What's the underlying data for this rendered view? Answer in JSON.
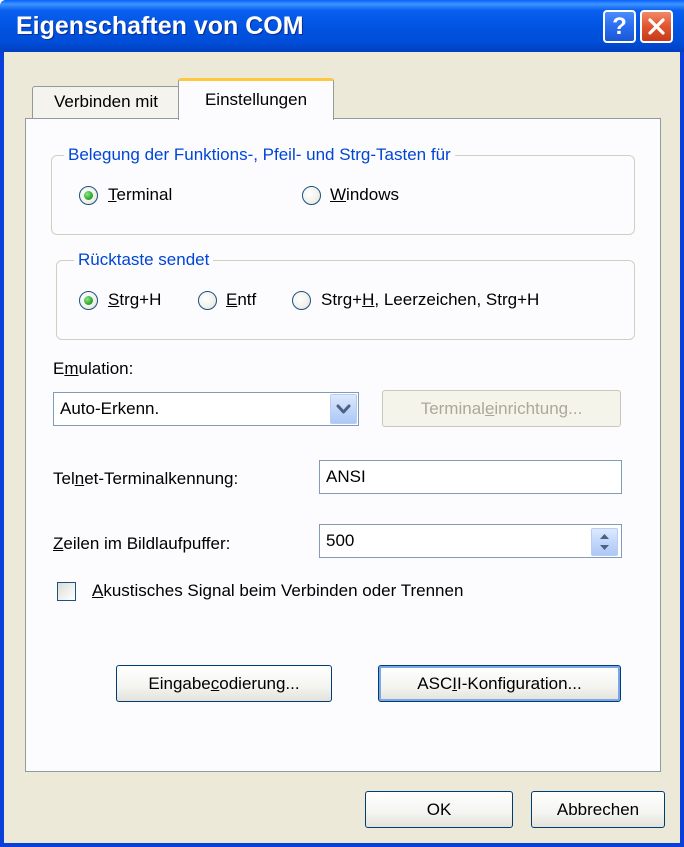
{
  "window": {
    "title": "Eigenschaften von COM",
    "help_glyph": "?",
    "close_glyph": "✕"
  },
  "tabs": [
    {
      "label": "Verbinden mit",
      "active": false
    },
    {
      "label": "Einstellungen",
      "active": true
    }
  ],
  "keys_group": {
    "legend": "Belegung der Funktions-, Pfeil- und Strg-Tasten für",
    "options": [
      {
        "label_pre": "",
        "label_ul": "T",
        "label_post": "erminal",
        "checked": true
      },
      {
        "label_pre": "",
        "label_ul": "W",
        "label_post": "indows",
        "checked": false
      }
    ]
  },
  "backspace_group": {
    "legend": "Rücktaste sendet",
    "options": [
      {
        "label_pre": "",
        "label_ul": "S",
        "label_post": "trg+H",
        "checked": true
      },
      {
        "label_pre": "",
        "label_ul": "E",
        "label_post": "ntf",
        "checked": false
      },
      {
        "label_pre": "Strg+",
        "label_ul": "H",
        "label_post": ", Leerzeichen, Strg+H",
        "checked": false
      }
    ]
  },
  "emulation": {
    "label_pre": "E",
    "label_ul": "m",
    "label_post": "ulation:",
    "value": "Auto-Erkenn.",
    "terminal_button_pre": "Terminal",
    "terminal_button_ul": "e",
    "terminal_button_post": "inrichtung..."
  },
  "telnet": {
    "label_pre": "Tel",
    "label_ul": "n",
    "label_post": "et-Terminalkennung:",
    "value": "ANSI"
  },
  "scrollback": {
    "label_pre": "",
    "label_ul": "Z",
    "label_post": "eilen im Bildlaufpuffer:",
    "value": "500"
  },
  "beep": {
    "label_pre": "",
    "label_ul": "A",
    "label_post": "kustisches Signal beim Verbinden oder Trennen",
    "checked": false
  },
  "buttons": {
    "input_encoding_pre": "Eingabe",
    "input_encoding_ul": "c",
    "input_encoding_post": "odierung...",
    "ascii_pre": "ASC",
    "ascii_ul": "I",
    "ascii_post": "I-Konfiguration...",
    "ok": "OK",
    "cancel": "Abbrechen"
  },
  "colors": {
    "title_blue": "#0054e3",
    "legend_blue": "#0046d5",
    "dialog_bg": "#ece9d8"
  }
}
